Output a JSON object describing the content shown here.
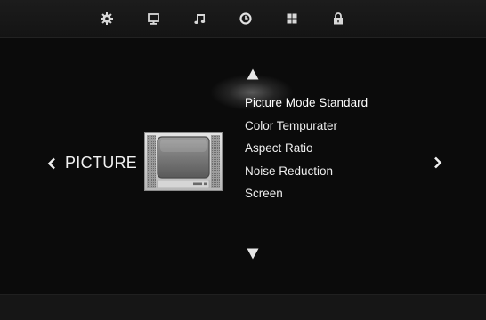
{
  "top_bar": {
    "icons": [
      {
        "name": "settings-gear-icon"
      },
      {
        "name": "monitor-icon"
      },
      {
        "name": "music-note-icon"
      },
      {
        "name": "clock-icon"
      },
      {
        "name": "grid-icon"
      },
      {
        "name": "lock-icon"
      }
    ]
  },
  "section": {
    "title": "PICTURE"
  },
  "menu": {
    "items": [
      {
        "label": "Picture Mode Standard"
      },
      {
        "label": "Color Tempurater"
      },
      {
        "label": "Aspect Ratio"
      },
      {
        "label": "Noise Reduction"
      },
      {
        "label": "Screen"
      }
    ],
    "selected_index": 0
  },
  "colors": {
    "background": "#0b0b0b",
    "text": "#eeeeee",
    "icon": "#d8d8d8"
  }
}
